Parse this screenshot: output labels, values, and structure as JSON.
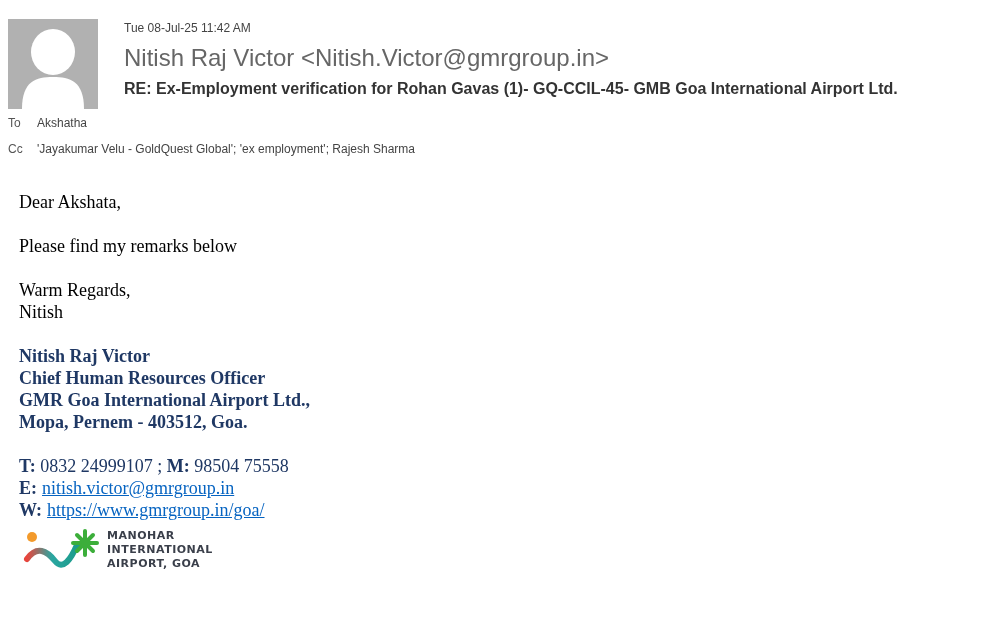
{
  "header": {
    "date": "Tue 08-Jul-25 11:42 AM",
    "sender": "Nitish Raj Victor <Nitish.Victor@gmrgroup.in>",
    "subject": "RE: Ex-Employment verification for Rohan Gavas (1)- GQ-CCIL-45- GMB Goa International Airport Ltd.",
    "recipients": [
      {
        "label": "To",
        "value": "Akshatha"
      },
      {
        "label": "Cc",
        "value": "'Jayakumar Velu - GoldQuest Global'; 'ex employment'; Rajesh Sharma"
      }
    ]
  },
  "body": {
    "paragraphs": [
      [
        "Dear Akshata,"
      ],
      [
        "Please find my remarks below"
      ],
      [
        "Warm Regards,",
        "Nitish"
      ]
    ]
  },
  "signature": {
    "lines": [
      "Nitish Raj Victor",
      "Chief Human Resources Officer",
      "GMR Goa International Airport Ltd.,",
      "Mopa, Pernem - 403512, Goa."
    ],
    "phone": "**T:** 0832 24999107 ; **M:** 98504 75558",
    "links": [
      {
        "label": "E:",
        "text": "nitish.victor@gmrgroup.in"
      },
      {
        "label": "W:",
        "text": "https://www.gmrgroup.in/goa/"
      }
    ],
    "logo_lines": [
      "MANOHAR",
      "INTERNATIONAL",
      "AIRPORT, GOA"
    ]
  }
}
